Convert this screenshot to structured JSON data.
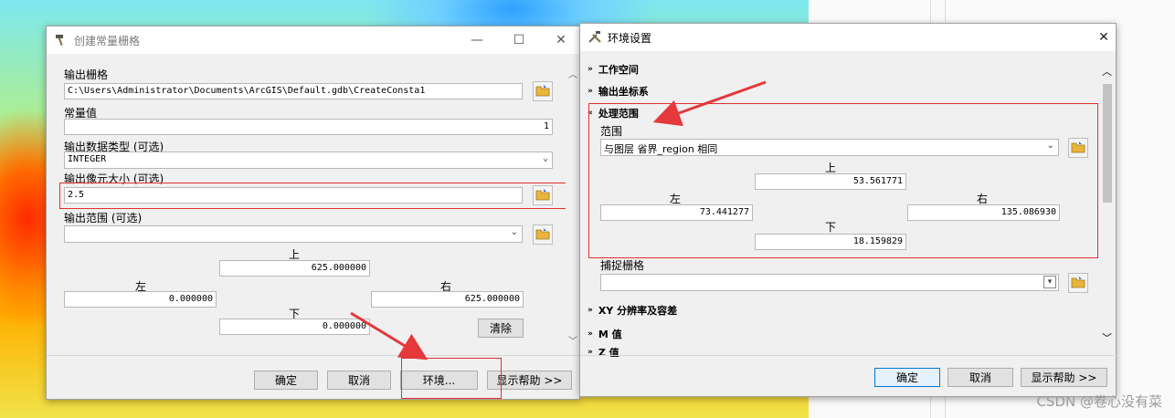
{
  "left_dialog": {
    "title": "创建常量栅格",
    "window_controls": {
      "minimize": "—",
      "maximize": "☐",
      "close": "✕"
    },
    "output_raster_label": "输出栅格",
    "output_raster_value": "C:\\Users\\Administrator\\Documents\\ArcGIS\\Default.gdb\\CreateConsta1",
    "constant_label": "常量值",
    "constant_value": "1",
    "data_type_label": "输出数据类型 (可选)",
    "data_type_value": "INTEGER",
    "cell_size_label": "输出像元大小 (可选)",
    "cell_size_value": "2.5",
    "extent_label": "输出范围 (可选)",
    "extent_value": "",
    "top_label": "上",
    "top_value": "625.000000",
    "left_label": "左",
    "left_value": "0.000000",
    "right_label": "右",
    "right_value": "625.000000",
    "bottom_label": "下",
    "bottom_value": "0.000000",
    "clear_button": "清除",
    "ok_button": "确定",
    "cancel_button": "取消",
    "env_button": "环境...",
    "help_button": "显示帮助 >>"
  },
  "right_dialog": {
    "title": "环境设置",
    "close": "✕",
    "sections": {
      "workspace": "工作空间",
      "output_coords": "输出坐标系",
      "processing_extent": "处理范围",
      "xy_resolution": "XY 分辨率及容差",
      "m_values": "M 值",
      "z_values": "Z 值"
    },
    "extent_label": "范围",
    "extent_value": "与图层 省界_region 相同",
    "top_label": "上",
    "top_value": "53.561771",
    "left_label": "左",
    "left_value": "73.441277",
    "right_label": "右",
    "right_value": "135.086930",
    "bottom_label": "下",
    "bottom_value": "18.159829",
    "snap_raster_label": "捕捉栅格",
    "snap_raster_value": "",
    "ok_button": "确定",
    "cancel_button": "取消",
    "help_button": "显示帮助 >>"
  },
  "watermark": "CSDN @卷心没有菜",
  "colors": {
    "annotation_red": "#e03030",
    "arrow_red": "#e5383b",
    "accent_blue": "#0078d7"
  }
}
